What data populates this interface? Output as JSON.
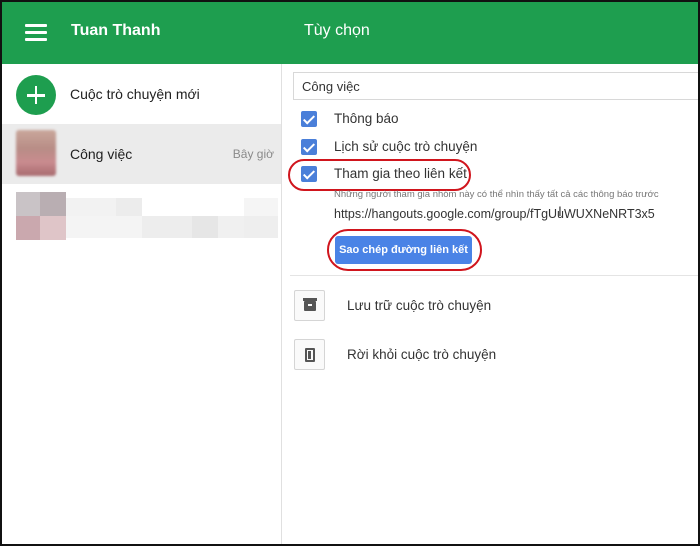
{
  "header": {
    "app_title": "Tuan Thanh",
    "pane_title": "Tùy chọn",
    "menu_icon": "hamburger-menu-icon",
    "background_color": "#1e9e4f"
  },
  "sidebar": {
    "new_chat_label": "Cuộc trò chuyện mới",
    "new_chat_icon": "plus-icon",
    "conversations": [
      {
        "name": "Công việc",
        "time": "Bây giờ",
        "selected": true
      }
    ]
  },
  "options": {
    "conversation_name": "Công việc",
    "checkboxes": [
      {
        "label": "Thông báo",
        "checked": true
      },
      {
        "label": "Lịch sử cuộc trò chuyện",
        "checked": true
      },
      {
        "label": "Tham gia theo liên kết",
        "checked": true
      }
    ],
    "join_hint": "Những người tham gia nhóm này có thể nhìn thấy tất cả các thông báo trước",
    "join_link": "https://hangouts.google.com/group/fTgUuWUXNeNRT3x5",
    "copy_link_button": "Sao chép đường liên kết",
    "actions": [
      {
        "label": "Lưu trữ cuộc trò chuyện",
        "icon": "archive-icon"
      },
      {
        "label": "Rời khỏi cuộc trò chuyện",
        "icon": "leave-door-icon"
      }
    ]
  },
  "colors": {
    "accent_green": "#1e9e4f",
    "checkbox_blue": "#4a7fd9",
    "button_blue": "#4a83e6",
    "highlight_red": "#d0151d"
  }
}
